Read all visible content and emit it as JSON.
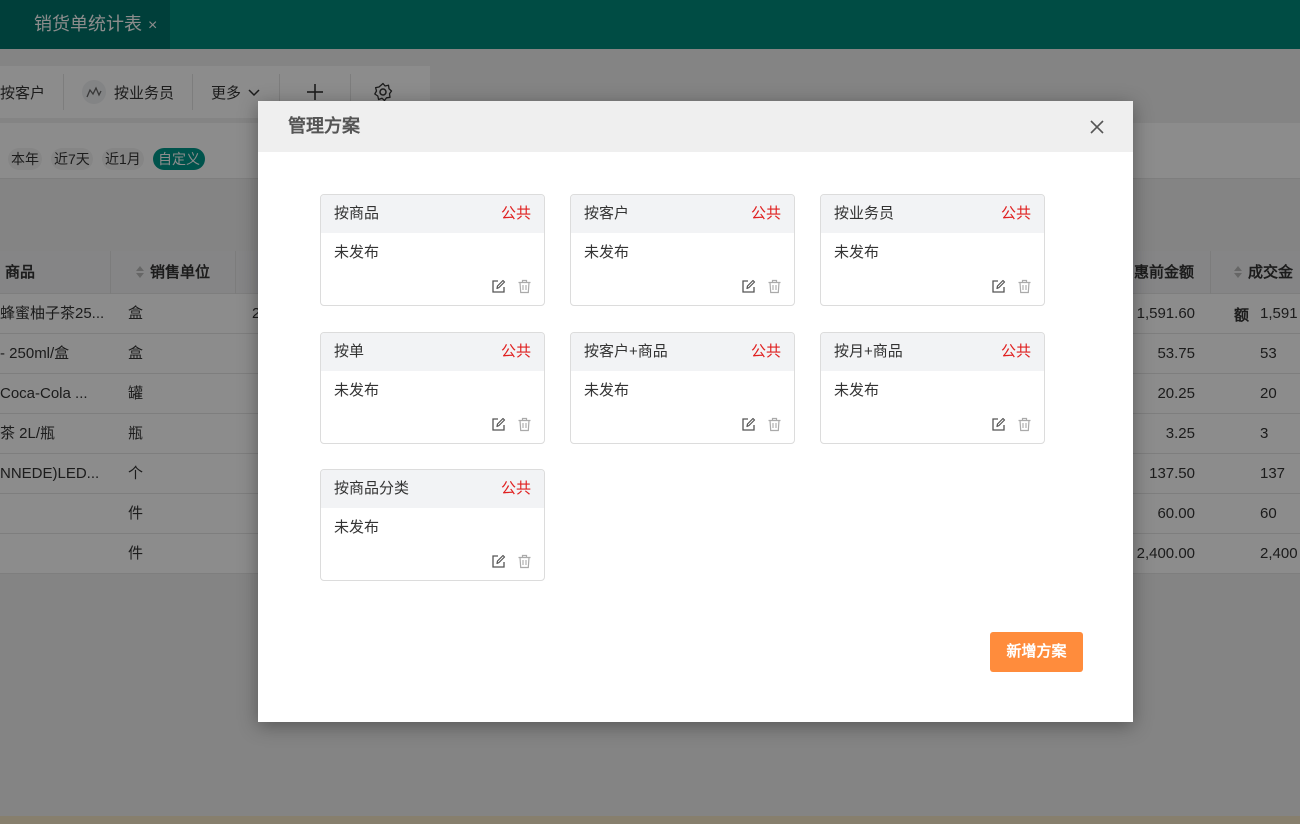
{
  "tab": {
    "title": "销货单统计表",
    "close_glyph": "×"
  },
  "toolbar": {
    "items": [
      {
        "label": "按客户"
      },
      {
        "label": "按业务员",
        "icon": "chart-icon"
      },
      {
        "label": "更多",
        "icon": "chevron-down-icon"
      }
    ],
    "add_icon": "plus-icon",
    "settings_icon": "gear-icon"
  },
  "date_filters": [
    "本年",
    "近7天",
    "近1月",
    "自定义"
  ],
  "date_filter_selected": "自定义",
  "table": {
    "headers": {
      "product": "商品",
      "unit": "销售单位",
      "pre_discount": "惠前金额",
      "deal": "成交金额"
    },
    "rows": [
      {
        "product": "蜂蜜柚子茶25...",
        "unit": "盒",
        "pre_discount": "1,591.60",
        "deal": "1,591"
      },
      {
        "product": "- 250ml/盒",
        "unit": "盒",
        "pre_discount": "53.75",
        "deal": "53"
      },
      {
        "product": "Coca-Cola ...",
        "unit": "罐",
        "pre_discount": "20.25",
        "deal": "20"
      },
      {
        "product": "茶 2L/瓶",
        "unit": "瓶",
        "pre_discount": "3.25",
        "deal": "3"
      },
      {
        "product": "NNEDE)LED...",
        "unit": "个",
        "pre_discount": "137.50",
        "deal": "137"
      },
      {
        "product": "",
        "unit": "件",
        "pre_discount": "60.00",
        "deal": "60"
      },
      {
        "product": "",
        "unit": "件",
        "pre_discount": "2,400.00",
        "deal": "2,400"
      }
    ],
    "col2_fragment": "2"
  },
  "modal": {
    "title": "管理方案",
    "close_icon": "close-icon",
    "schemes": [
      {
        "name": "按商品",
        "badge": "公共",
        "status": "未发布"
      },
      {
        "name": "按客户",
        "badge": "公共",
        "status": "未发布"
      },
      {
        "name": "按业务员",
        "badge": "公共",
        "status": "未发布"
      },
      {
        "name": "按单",
        "badge": "公共",
        "status": "未发布"
      },
      {
        "name": "按客户+商品",
        "badge": "公共",
        "status": "未发布"
      },
      {
        "name": "按月+商品",
        "badge": "公共",
        "status": "未发布"
      },
      {
        "name": "按商品分类",
        "badge": "公共",
        "status": "未发布"
      }
    ],
    "add_button": "新增方案"
  },
  "colors": {
    "teal": "#008b7d",
    "accent_orange": "#ff8c3c",
    "badge_red": "#e02020"
  }
}
